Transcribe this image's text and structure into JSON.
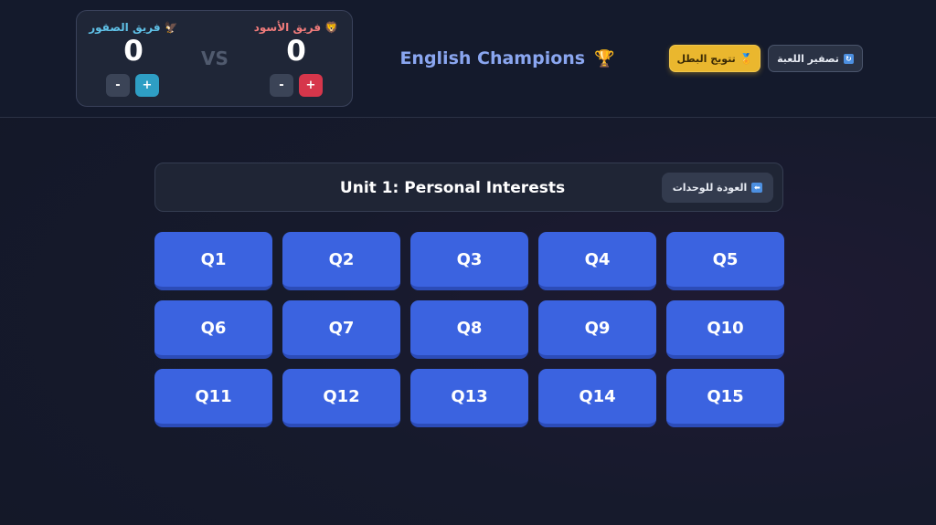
{
  "scoreboard": {
    "falcons": {
      "name": "فريق الصقور",
      "icon": "eagle-icon",
      "score": "0",
      "minus_label": "-",
      "plus_label": "+",
      "color": "#5fc0e6"
    },
    "lions": {
      "name": "فريق الأسود",
      "icon": "lion-icon",
      "score": "0",
      "minus_label": "-",
      "plus_label": "+",
      "color": "#f07b7b"
    },
    "vs_label": "VS"
  },
  "header": {
    "title": "English Champions",
    "title_icon": "trophy-icon",
    "crown_button": {
      "label": "تتويج البطل",
      "icon": "crown-icon",
      "color": "#eab72e"
    },
    "reset_button": {
      "label": "تصفير اللعبة",
      "icon": "reset-icon"
    }
  },
  "unit": {
    "title": "Unit 1: Personal Interests",
    "back_button": {
      "label": "العودة للوحدات",
      "icon": "back-arrow-icon"
    }
  },
  "questions": [
    "Q1",
    "Q2",
    "Q3",
    "Q4",
    "Q5",
    "Q6",
    "Q7",
    "Q8",
    "Q9",
    "Q10",
    "Q11",
    "Q12",
    "Q13",
    "Q14",
    "Q15"
  ],
  "colors": {
    "question_button": "#3b63e0",
    "accent": "#8aa6f0"
  }
}
